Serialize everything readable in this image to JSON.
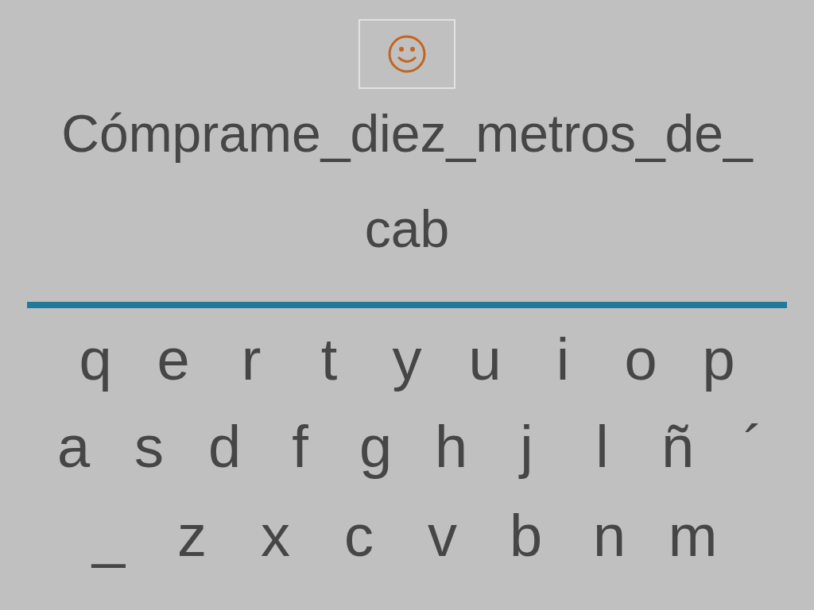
{
  "phrase_lines": [
    "Cómprame_diez_metros_de_",
    "cab"
  ],
  "keyboard_rows": [
    [
      "q",
      "e",
      "r",
      "t",
      "y",
      "u",
      "i",
      "o",
      "p"
    ],
    [
      "a",
      "s",
      "d",
      "f",
      "g",
      "h",
      "j",
      "l",
      "ñ",
      "´"
    ],
    [
      "_",
      "z",
      "x",
      "c",
      "v",
      "b",
      "n",
      "m"
    ]
  ]
}
